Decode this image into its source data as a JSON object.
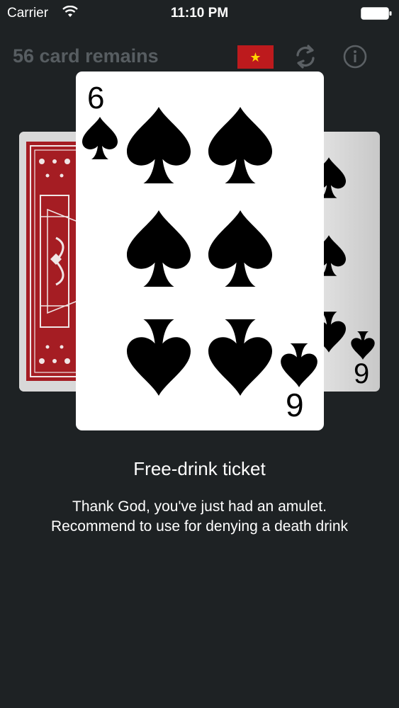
{
  "status_bar": {
    "carrier": "Carrier",
    "time": "11:10 PM"
  },
  "header": {
    "remaining_label": "56 card remains",
    "flag_icon": "vietnam-flag-icon",
    "refresh_icon": "refresh-icon",
    "info_icon": "info-icon"
  },
  "cards": {
    "front": {
      "rank_top": "6",
      "rank_bottom": "9",
      "suit": "spades"
    },
    "right": {
      "rank": "9",
      "suit": "spades"
    },
    "back": {
      "design": "red-card-back"
    }
  },
  "result": {
    "title": "Free-drink ticket",
    "line1": "Thank God, you've just had an amulet.",
    "line2": "Recommend to use for denying a death drink"
  },
  "colors": {
    "background": "#1e2224",
    "header_text": "#575d61",
    "flag_red": "#bd1a1d",
    "flag_star": "#ffd500",
    "card_back_red": "#a51d23"
  }
}
